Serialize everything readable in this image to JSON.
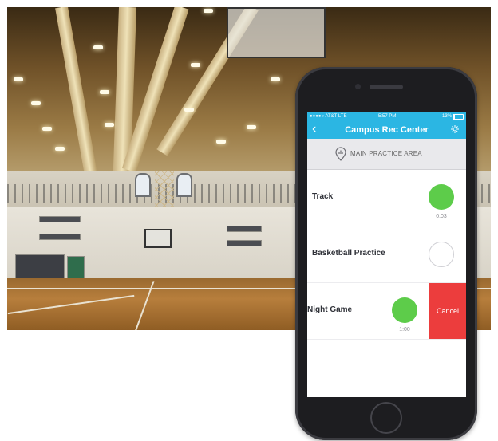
{
  "status_bar": {
    "carrier": "●●●●○ AT&T  LTE",
    "time": "5:57 PM",
    "battery": "13%"
  },
  "nav": {
    "back_icon": "chevron-left-icon",
    "title": "Campus Rec Center",
    "settings_icon": "gear-icon"
  },
  "area": {
    "icon": "location-pin-icon",
    "label": "MAIN PRACTICE AREA"
  },
  "rows": [
    {
      "name": "Track",
      "active": true,
      "time": "0:03"
    },
    {
      "name": "Basketball Practice",
      "active": false,
      "time": ""
    },
    {
      "name": "Night Game",
      "active": true,
      "time": "1:00",
      "swipe_action": "Cancel"
    }
  ],
  "colors": {
    "accent": "#2bb6e3",
    "active_dot": "#5dcc4a",
    "cancel": "#ec3d3d"
  }
}
